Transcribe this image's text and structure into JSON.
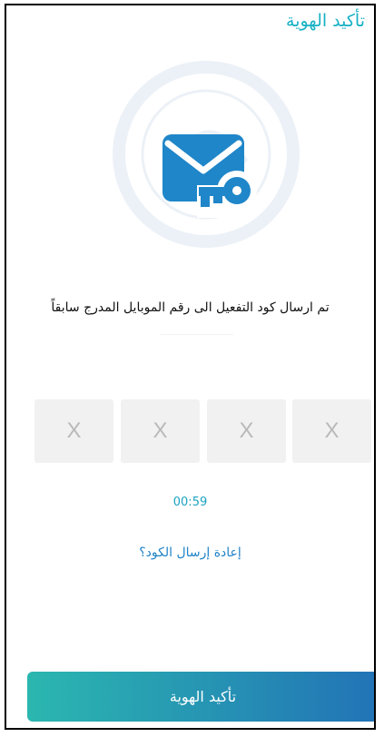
{
  "header": {
    "title": "تأكيد الهوية"
  },
  "icons": {
    "watermark": "organization-seal-watermark",
    "hero": "mail-key-icon"
  },
  "main": {
    "message": "تم ارسال كود التفعيل الى رقم الموبايل المدرج سابقاً",
    "code_boxes": [
      "X",
      "X",
      "X",
      "X"
    ],
    "timer": "00:59",
    "resend_link": "إعادة إرسال الكود؟"
  },
  "footer": {
    "confirm_button": "تأكيد الهوية"
  },
  "colors": {
    "title": "#17b1c4",
    "timer": "#1aa3c1",
    "link": "#2284c8",
    "button_gradient_start": "#2bb7b0",
    "button_gradient_end": "#2273b6",
    "code_box_bg": "#f1f1f1",
    "code_box_text": "#b9b9b9"
  }
}
